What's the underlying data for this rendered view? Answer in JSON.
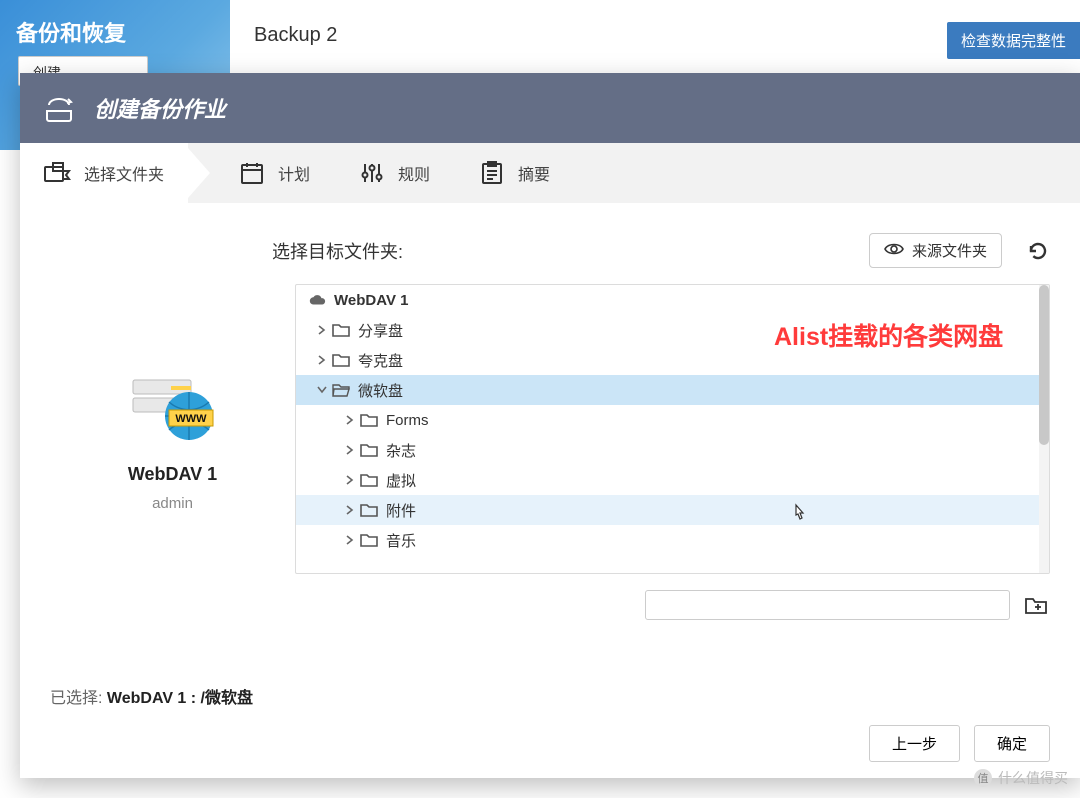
{
  "bg": {
    "app_title": "备份和恢复",
    "create_btn": "创建",
    "task_name": "Backup 2",
    "check_btn": "检查数据完整性"
  },
  "dialog": {
    "title": "创建备份作业"
  },
  "steps": {
    "folder": "选择文件夹",
    "schedule": "计划",
    "rules": "规则",
    "summary": "摘要"
  },
  "body": {
    "select_target_label": "选择目标文件夹:",
    "source_folder_btn": "来源文件夹"
  },
  "webdav": {
    "name": "WebDAV 1",
    "user": "admin"
  },
  "tree": {
    "root": "WebDAV 1",
    "items": [
      {
        "label": "分享盘",
        "depth": 1,
        "expanded": false,
        "selected": false
      },
      {
        "label": "夸克盘",
        "depth": 1,
        "expanded": false,
        "selected": false
      },
      {
        "label": "微软盘",
        "depth": 1,
        "expanded": true,
        "selected": true,
        "folder_open": true
      },
      {
        "label": "Forms",
        "depth": 2,
        "expanded": false,
        "selected": false
      },
      {
        "label": "杂志",
        "depth": 2,
        "expanded": false,
        "selected": false
      },
      {
        "label": "虚拟",
        "depth": 2,
        "expanded": false,
        "selected": false
      },
      {
        "label": "附件",
        "depth": 2,
        "expanded": false,
        "selected": false,
        "hover": true
      },
      {
        "label": "音乐",
        "depth": 2,
        "expanded": false,
        "selected": false
      }
    ]
  },
  "annotation": "Alist挂载的各类网盘",
  "selected": {
    "label": "已选择: ",
    "value": "WebDAV 1 : /微软盘"
  },
  "footer": {
    "prev": "上一步",
    "ok": "确定"
  },
  "watermark": "什么值得买"
}
